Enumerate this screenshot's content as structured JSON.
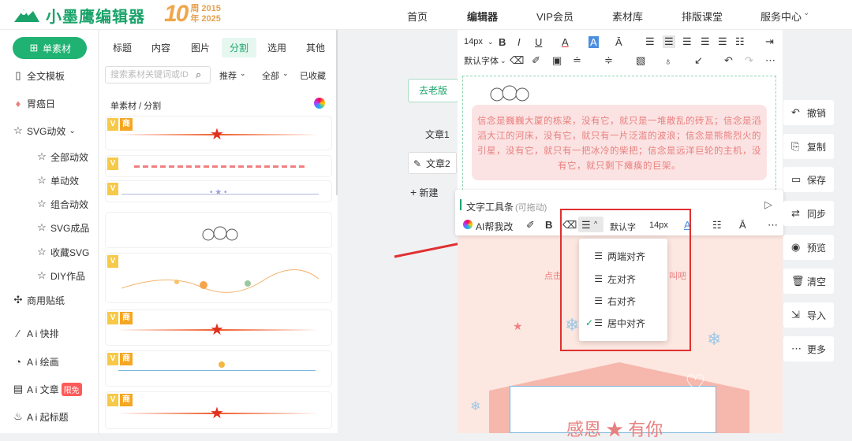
{
  "header": {
    "brand": "小墨鹰编辑器",
    "anniv_num": "10",
    "anniv_line1": "周 2015",
    "anniv_line2": "年 2025",
    "nav": [
      "首页",
      "编辑器",
      "VIP会员",
      "素材库",
      "排版课堂",
      "服务中心"
    ],
    "nav_active": "编辑器"
  },
  "sidebar": {
    "items": [
      "单素材",
      "全文模板",
      "胃癌日",
      "SVG动效",
      "全部动效",
      "单动效",
      "组合动效",
      "SVG成品",
      "收藏SVG",
      "DIY作品",
      "商用贴纸",
      "A i 快排",
      "A i 绘画",
      "A i 文章",
      "A i 起标题"
    ],
    "badge": "限免"
  },
  "panel": {
    "tabs": [
      "标题",
      "内容",
      "图片",
      "分割",
      "选用",
      "其他"
    ],
    "active_tab": "分割",
    "search_placeholder": "搜索素材关键词或ID",
    "filters": [
      "推荐",
      "全部",
      "已收藏"
    ],
    "breadcrumb": "单素材 / 分割",
    "tag_v": "V",
    "tag_s": "商"
  },
  "canvas": {
    "old_version": "去老版",
    "articles": [
      "文章1",
      "文章2"
    ],
    "new_label": "新建"
  },
  "toolbar": {
    "font_size": "14px",
    "font_family": "默认字体"
  },
  "content": {
    "quote": "信念是巍巍大厦的栋梁，没有它，就只是一堆散乱的砖瓦；信念是滔滔大江的河床，没有它，就只有一片泛滥的波浪；信念是熊熊烈火的引星，没有它，就只有一把冰冷的柴把；信念是远洋巨轮的主机，没有它，就只剩下瘫痪的巨架。",
    "poster_title": "感恩 ★ 有你",
    "banner_left": "点击",
    "banner_right": "叫吧"
  },
  "floating_toolbar": {
    "title": "文字工具条",
    "subtitle": "(可拖动)",
    "ai": "AI帮我改",
    "font": "默认字",
    "size": "14px"
  },
  "align_dropdown": {
    "options": [
      "两端对齐",
      "左对齐",
      "右对齐",
      "居中对齐"
    ],
    "selected": "居中对齐"
  },
  "right_tools": [
    "撤销",
    "复制",
    "保存",
    "同步",
    "预览",
    "清空",
    "导入",
    "更多"
  ],
  "colors": {
    "brand": "#1fb272",
    "accent": "#e03030",
    "quote_text": "#e8807f"
  }
}
